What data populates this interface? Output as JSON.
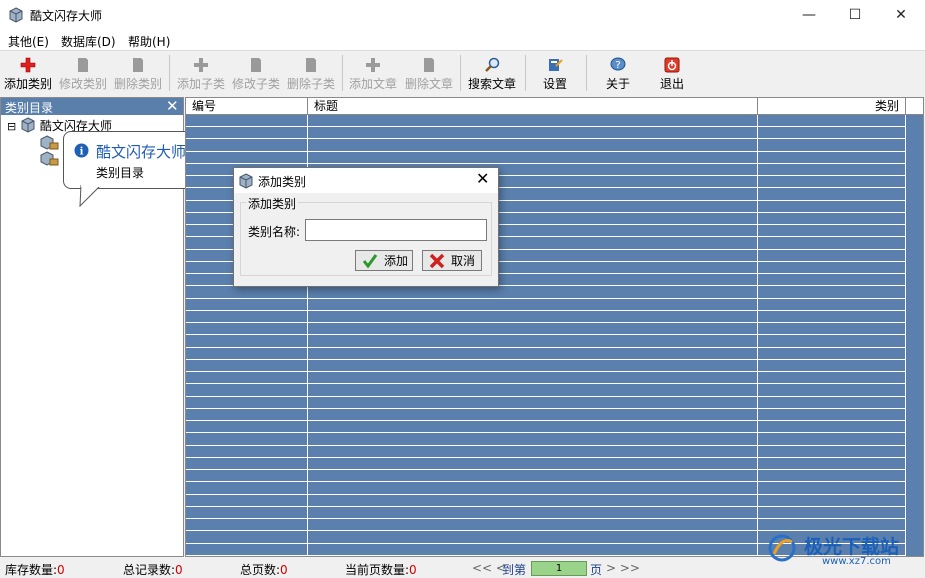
{
  "window": {
    "title": "酷文闪存大师",
    "minimize": "—",
    "maximize": "☐",
    "close": "✕"
  },
  "menu": [
    "其他(E)",
    "数据库(D)",
    "帮助(H)"
  ],
  "toolbar": {
    "add_category": "添加类别",
    "edit_category": "修改类别",
    "delete_category": "删除类别",
    "add_subcategory": "添加子类",
    "edit_subcategory": "修改子类",
    "delete_subcategory": "删除子类",
    "add_article": "添加文章",
    "delete_article": "删除文章",
    "search_article": "搜索文章",
    "settings": "设置",
    "about": "关于",
    "exit": "退出"
  },
  "left_panel": {
    "title": "类别目录",
    "close": "✕",
    "tree_root": "酷文闪存大师",
    "tree_expander": "⊟"
  },
  "balloon": {
    "title": "酷文闪存大师",
    "text": "类别目录"
  },
  "grid": {
    "columns": [
      "编号",
      "标题",
      "类别"
    ],
    "row_count": 36
  },
  "dialog": {
    "title": "添加类别",
    "close": "✕",
    "group_label": "添加类别",
    "field_label": "类别名称:",
    "field_value": "",
    "ok": "添加",
    "cancel": "取消"
  },
  "status": {
    "stock_label": "库存数量:",
    "stock_value": "0",
    "records_label": "总记录数:",
    "records_value": "0",
    "pages_label": "总页数:",
    "pages_value": "0",
    "current_label": "当前页数量:",
    "current_value": "0",
    "prev": "<< <",
    "goto": "到第",
    "page_value": "1",
    "page_unit": "页",
    "next": "> >>"
  },
  "watermark": {
    "text": "极光下载站",
    "url": "www.xz7.com"
  },
  "colors": {
    "grid_bg": "#5b80ae",
    "panel_header": "#5a7fab",
    "status_value": "#d00000",
    "accent": "#1e5bb8"
  }
}
